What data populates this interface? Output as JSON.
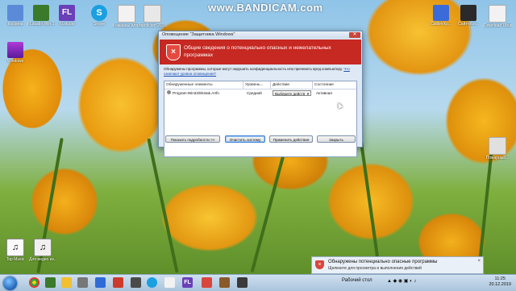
{
  "watermark": "www.BANDICAM.com",
  "desktop_icons": [
    {
      "label": "Корзина",
      "icon": "recycle-bin-icon",
      "color": "#5b8bd8"
    },
    {
      "label": "FLstudio Win 1.83",
      "icon": "minecraft-icon",
      "color": "#3b7a2a"
    },
    {
      "label": "FLstudio",
      "icon": "fl-icon",
      "color": "#6a3fb8"
    },
    {
      "label": "Skype",
      "icon": "skype-icon",
      "color": "#1aa0e0"
    },
    {
      "label": "Команды для Mi...",
      "icon": "document-icon",
      "color": "#f2f2f2"
    },
    {
      "label": "bandicam 2015-02...",
      "icon": "document-icon",
      "color": "#e8e8e8"
    },
    {
      "label": "Windows",
      "icon": "winrar-icon",
      "color": "#8a2be2"
    },
    {
      "label": "Top Music",
      "icon": "music-icon",
      "color": "#fafafa"
    },
    {
      "label": "Для видео из...",
      "icon": "music-icon",
      "color": "#f0f0f0"
    },
    {
      "label": "CalibreXp...",
      "icon": "app-icon",
      "color": "#3b6bd8"
    },
    {
      "label": "Сайт-обл...",
      "icon": "winamp-icon",
      "color": "#2a2a2a"
    },
    {
      "label": "Download Ubuntu...",
      "icon": "document-icon",
      "color": "#f2f2f2"
    },
    {
      "label": "Пожарный...",
      "icon": "document-icon",
      "color": "#e0e0e0"
    }
  ],
  "dialog": {
    "title": "Оповещение \"Защитника Windows\"",
    "close": "✕",
    "header_title": "Общие сведения о потенциально опасных и нежелательных программах",
    "description": "Обнаружены программы, которые могут нарушить конфиденциальность или причинить вред компьютеру.",
    "link": "Что означают уровни оповещения?",
    "columns": [
      "Обнаруженные элементы",
      "Уровень...",
      "Действие",
      "Состояние"
    ],
    "rows": [
      {
        "item": "Program:Win32/Ekstak.A!rfn",
        "level": "Средний",
        "action": "Выберите действ",
        "status": "Активная"
      }
    ],
    "buttons": {
      "details": "Показать подробности >>",
      "clean": "Очистить систему",
      "apply": "Применить действия",
      "close": "Закрыть"
    }
  },
  "notification": {
    "title": "Обнаружены потенциально опасные программы",
    "subtitle": "Щелкните для просмотра и выполнения действий",
    "close": "×"
  },
  "taskbar": {
    "desktop_label": "Рабочий стол",
    "clock_time": "11:25",
    "clock_date": "20.12.2019"
  }
}
